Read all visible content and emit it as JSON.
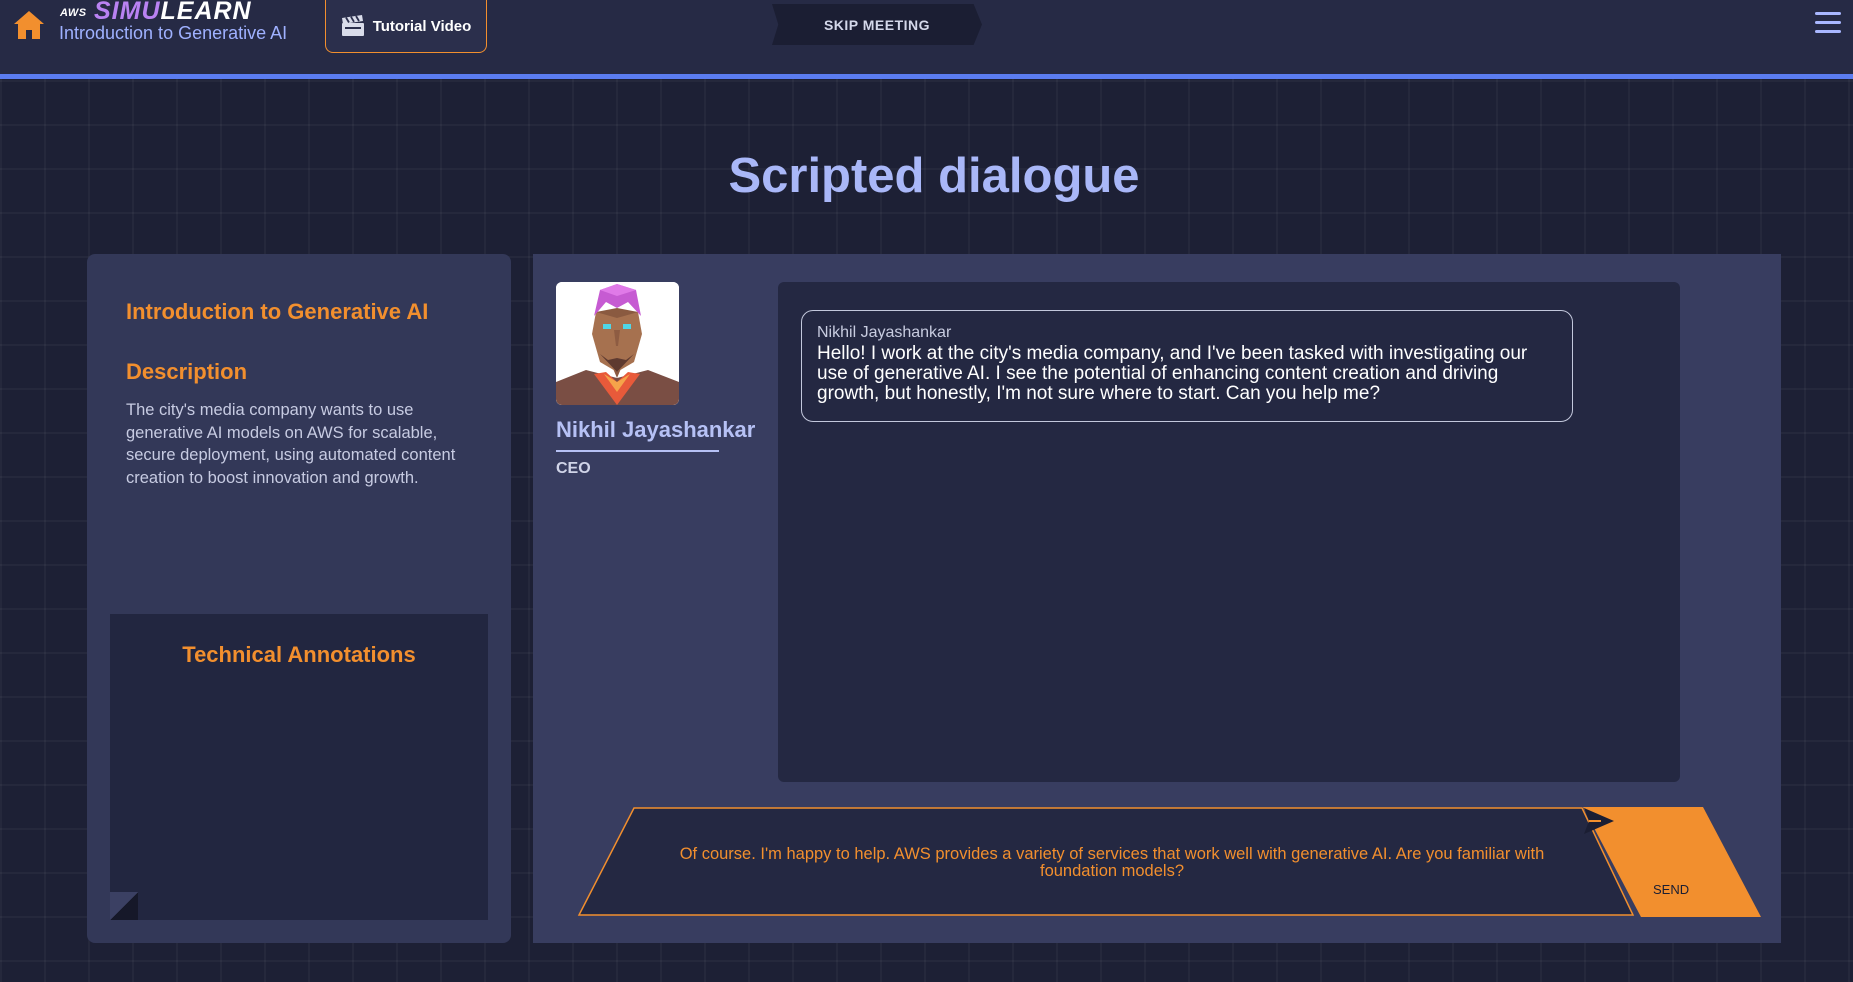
{
  "header": {
    "brand_aws": "AWS",
    "brand_simu": "SIMU",
    "brand_learn": "LEARN",
    "course_subtitle": "Introduction to Generative AI",
    "tutorial_label": "Tutorial Video",
    "skip_label": "SKIP MEETING"
  },
  "page_title": "Scripted dialogue",
  "left_panel": {
    "course_title": "Introduction to Generative AI",
    "description_heading": "Description",
    "description_text": "The city's media company wants to use generative AI models on AWS for scalable, secure deployment, using automated content creation to boost innovation and growth.",
    "annotations_title": "Technical Annotations"
  },
  "character": {
    "name": "Nikhil Jayashankar",
    "role": "CEO"
  },
  "chat": {
    "messages": [
      {
        "speaker": "Nikhil Jayashankar",
        "text": "Hello! I work at the city's media company, and I've been tasked with investigating our use of generative AI. I see the potential of enhancing content creation and driving growth, but honestly, I'm not sure where to start. Can you help me?"
      }
    ]
  },
  "reply": {
    "text": "Of course. I'm happy to help. AWS provides a variety of services that work well with generative AI. Are you familiar with foundation models?",
    "send_label": "SEND"
  },
  "icons": {
    "home": "home-icon",
    "tutorial": "clapperboard-icon",
    "menu": "hamburger-menu-icon",
    "send": "paper-plane-icon"
  },
  "colors": {
    "accent_orange": "#f28f2e",
    "accent_blue": "#5b7cf0",
    "title_lavender": "#a9b7f8",
    "background": "#1d2035"
  }
}
